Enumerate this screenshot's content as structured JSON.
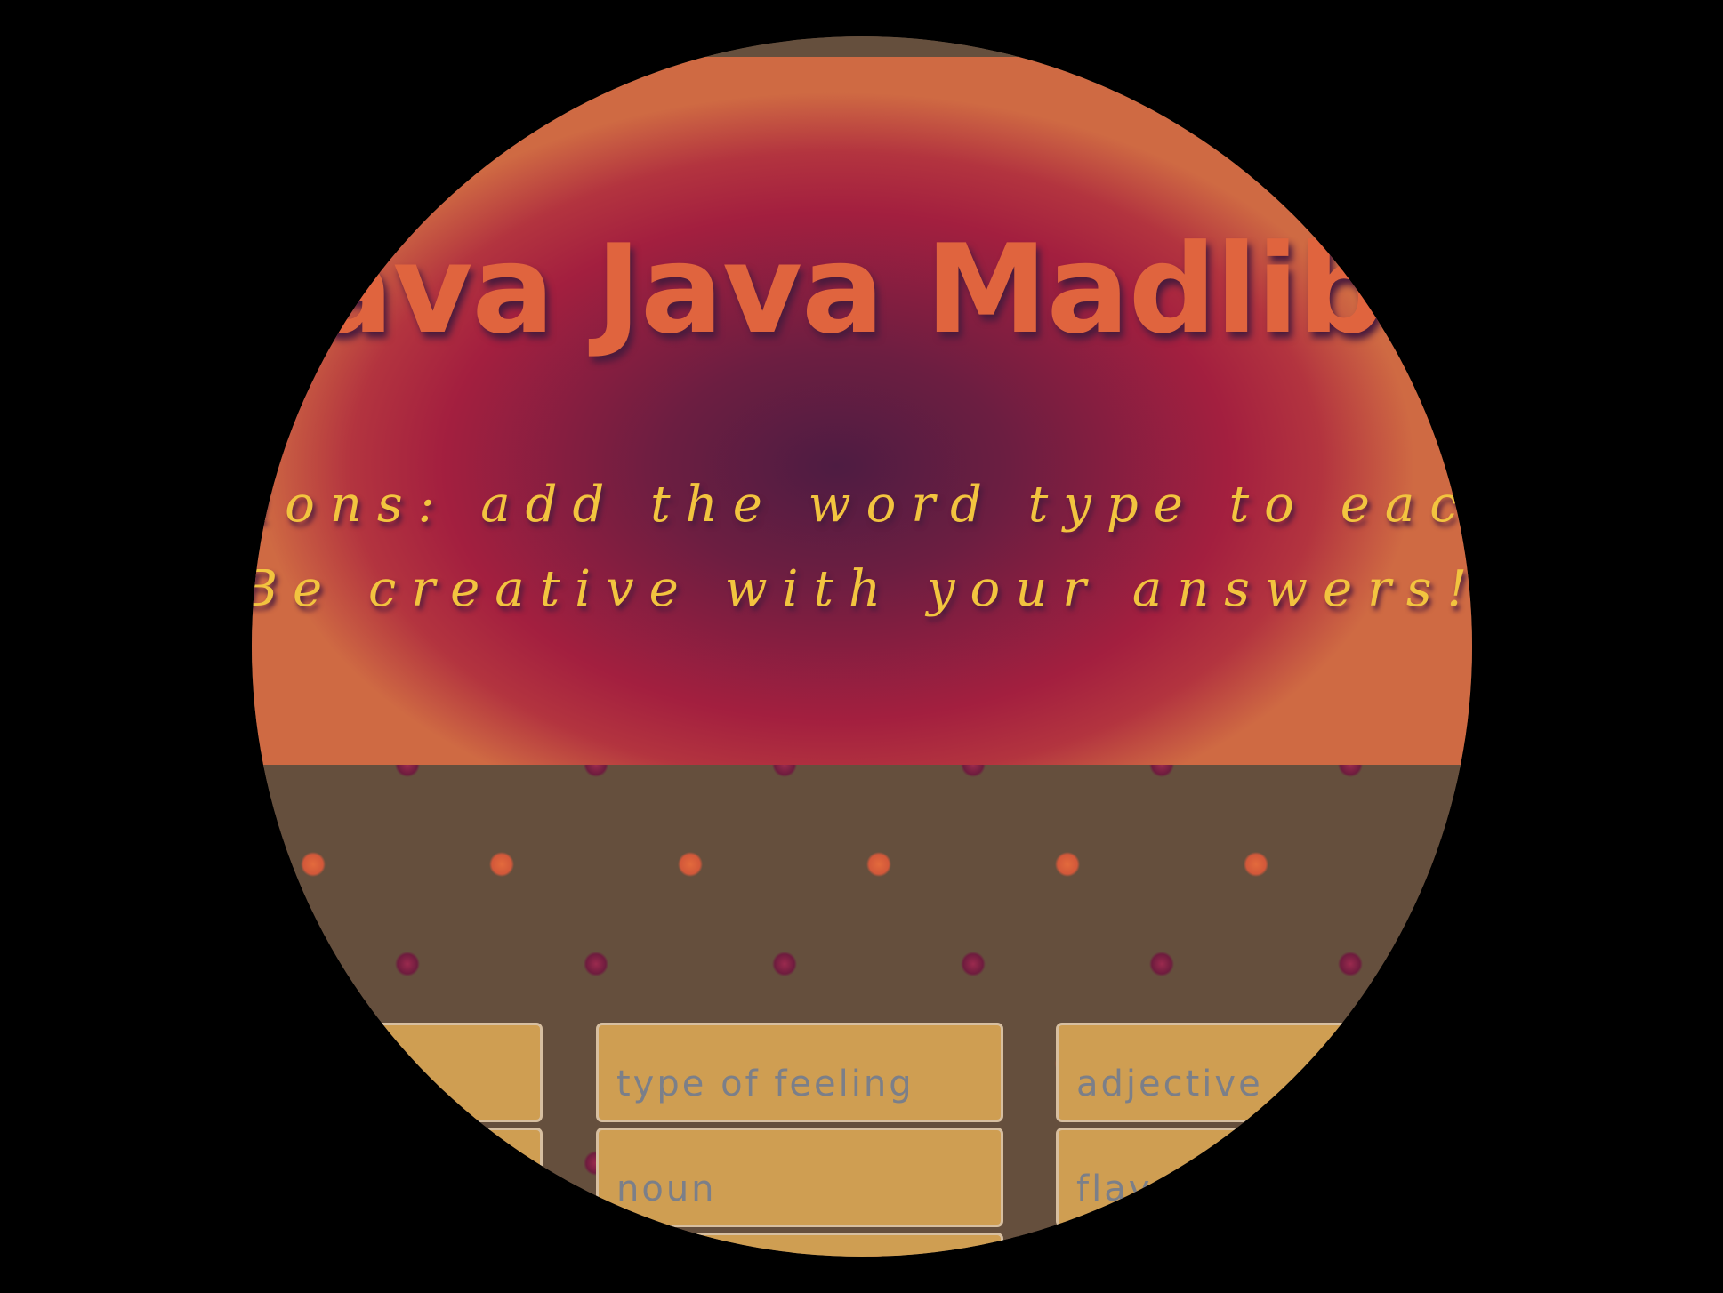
{
  "header": {
    "title": "Java Java Madlibs",
    "instructions_line_1": "Directions: add the word type to each box.",
    "instructions_line_2": "Be creative with your answers!"
  },
  "form": {
    "fields": [
      {
        "placeholder": ""
      },
      {
        "placeholder": "type of feeling"
      },
      {
        "placeholder": "adjective"
      },
      {
        "placeholder": ""
      },
      {
        "placeholder": "noun"
      },
      {
        "placeholder": "flavor"
      },
      {
        "placeholder": ""
      }
    ]
  },
  "colors": {
    "title": "#e0643e",
    "instructions": "#f2c43f",
    "board_background": "#654f3d",
    "field_background": "#cf9e52"
  }
}
